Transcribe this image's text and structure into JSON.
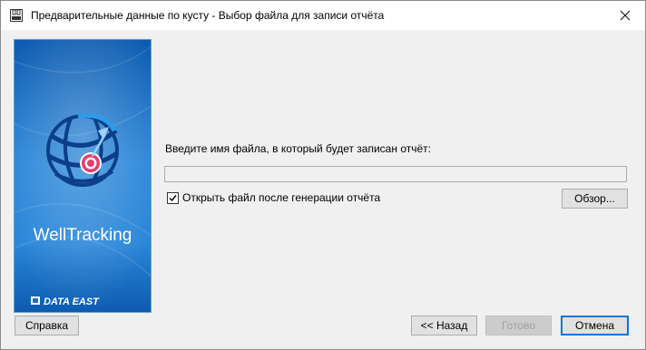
{
  "window": {
    "title": "Предварительные данные по кусту - Выбор файла для записи отчёта",
    "icon": "app-window-icon",
    "close_icon": "close-icon"
  },
  "banner": {
    "brand": "WellTracking",
    "company": "DATA EAST",
    "bg_color": "#1e6fc0",
    "accent_color": "#e63c6e"
  },
  "form": {
    "prompt": "Введите имя файла, в который будет записан отчёт:",
    "file_value": "",
    "file_placeholder": "",
    "open_after_label": "Открыть файл после генерации отчёта",
    "open_after_checked": true,
    "browse_label": "Обзор..."
  },
  "buttons": {
    "help": "Справка",
    "back": "<< Назад",
    "finish": "Готово",
    "cancel": "Отмена"
  }
}
